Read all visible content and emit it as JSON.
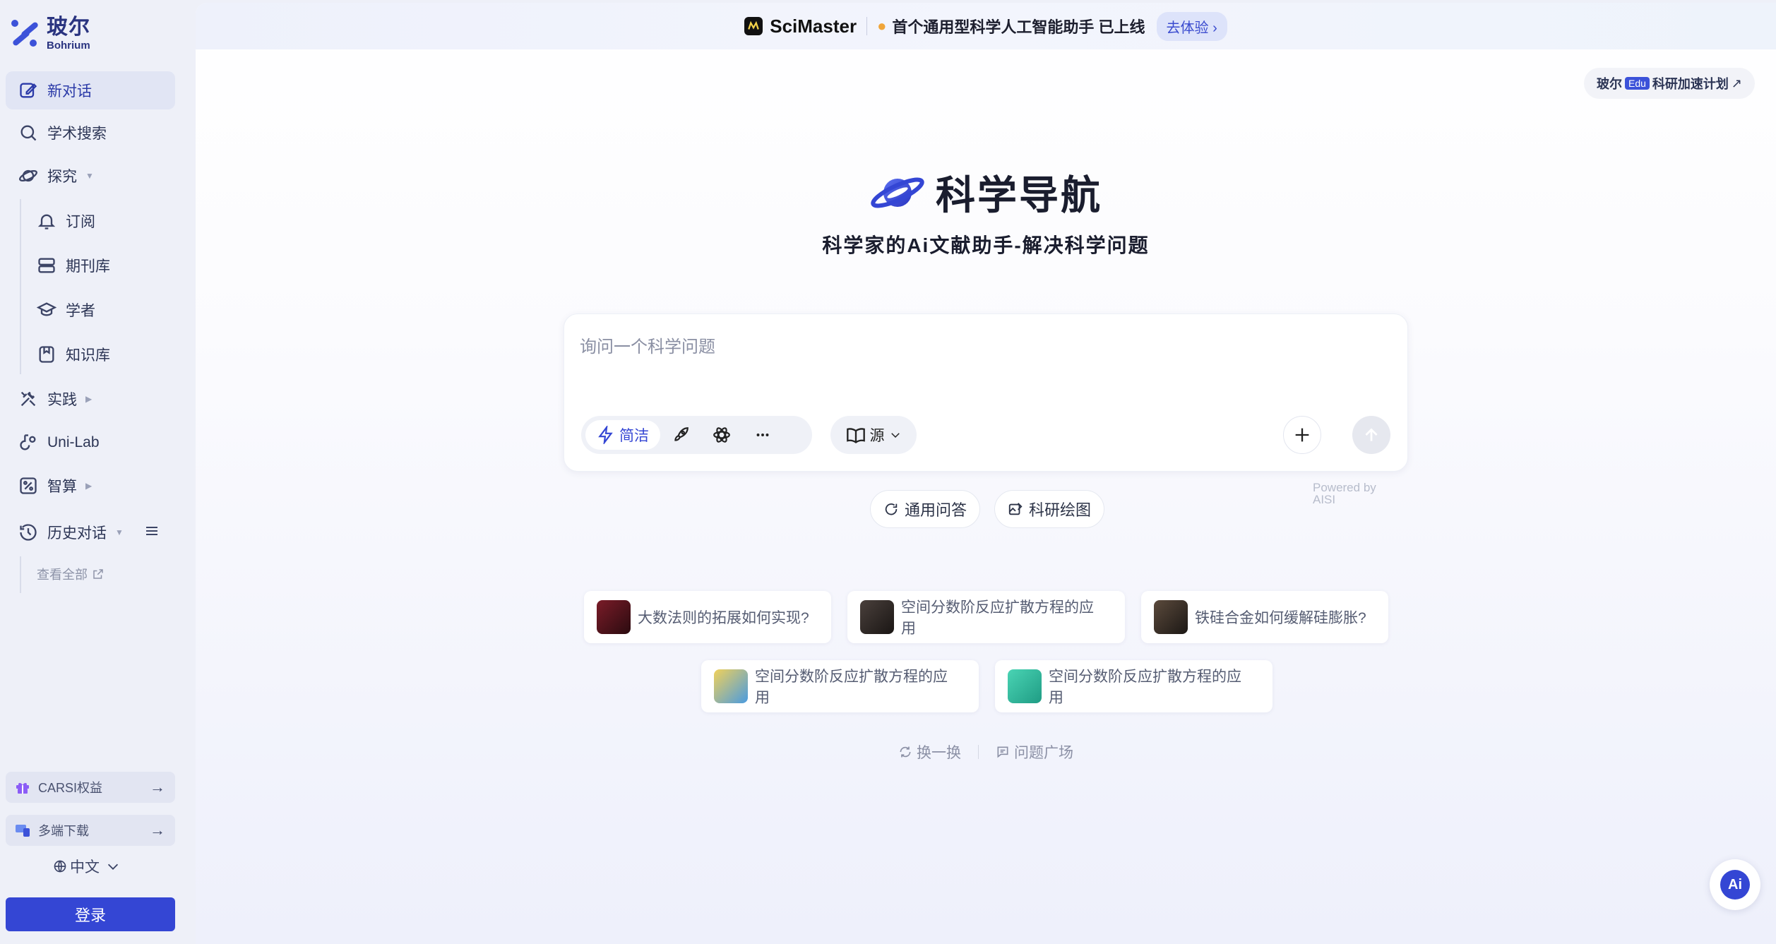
{
  "brand": {
    "name_cn": "玻尔",
    "name_en": "Bohrium"
  },
  "sidebar": {
    "items": [
      {
        "label": "新对话",
        "icon": "edit-icon"
      },
      {
        "label": "学术搜索",
        "icon": "search-icon"
      },
      {
        "label": "探究",
        "icon": "planet-icon"
      },
      {
        "label": "订阅",
        "icon": "bell-icon"
      },
      {
        "label": "期刊库",
        "icon": "stack-icon"
      },
      {
        "label": "学者",
        "icon": "graduation-cap-icon"
      },
      {
        "label": "知识库",
        "icon": "book-icon"
      },
      {
        "label": "实践",
        "icon": "tools-icon"
      },
      {
        "label": "Uni-Lab",
        "icon": "flask-icon"
      },
      {
        "label": "智算",
        "icon": "percent-icon"
      },
      {
        "label": "历史对话",
        "icon": "history-icon"
      }
    ],
    "view_all": "查看全部",
    "carsi": "CARSI权益",
    "download": "多端下载",
    "language": "中文",
    "login": "登录"
  },
  "banner": {
    "brand": "SciMaster",
    "text": "首个通用型科学人工智能助手  已上线",
    "cta": "去体验"
  },
  "edu": {
    "prefix": "玻尔",
    "tag": "Edu",
    "suffix": "科研加速计划"
  },
  "hero": {
    "title": "科学导航",
    "subtitle": "科学家的Ai文献助手-解决科学问题"
  },
  "input": {
    "placeholder": "询问一个科学问题",
    "mode_active": "简洁",
    "source": "源",
    "powered": [
      "Powered by",
      "AISI"
    ]
  },
  "chips": [
    {
      "label": "通用问答"
    },
    {
      "label": "科研绘图"
    }
  ],
  "questions": [
    {
      "label": "大数法则的拓展如何实现?",
      "thumb_color": "#5a1a22"
    },
    {
      "label": "空间分数阶反应扩散方程的应用",
      "thumb_color": "#3a3230"
    },
    {
      "label": "铁硅合金如何缓解硅膨胀?",
      "thumb_color": "#2e2a26"
    },
    {
      "label": "空间分数阶反应扩散方程的应用",
      "thumb_color": "#e6c24a"
    },
    {
      "label": "空间分数阶反应扩散方程的应用",
      "thumb_color": "#34c9a8"
    }
  ],
  "footer_links": {
    "refresh": "换一换",
    "square": "问题广场"
  },
  "fab": {
    "label": "Ai"
  },
  "colors": {
    "accent": "#3446d4",
    "brand_dark": "#2a3480"
  }
}
